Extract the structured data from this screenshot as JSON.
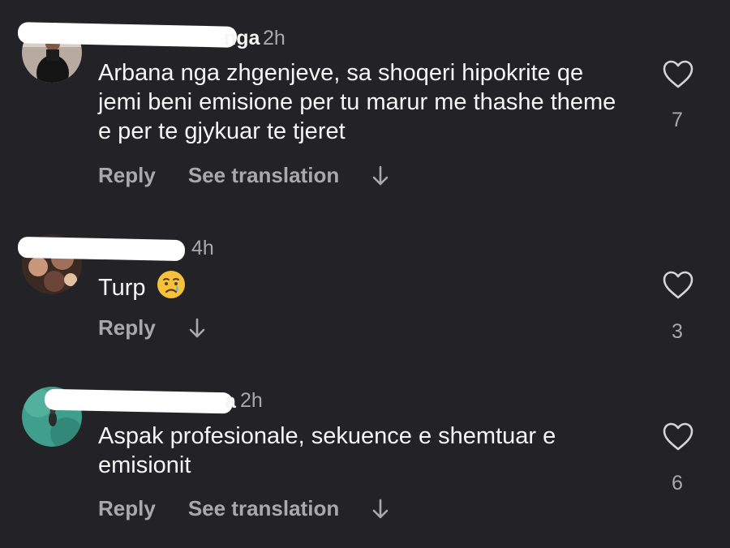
{
  "comments": [
    {
      "username_visible": "nga",
      "time": "2h",
      "text": "Arbana nga zhgenjeve, sa shoqeri hipokrite qe jemi beni emisione per tu marur me thashe theme e per te gjykuar te tjeret",
      "reply_label": "Reply",
      "translate_label": "See translation",
      "likes": "7"
    },
    {
      "time": "4h",
      "text": "Turp",
      "emoji": "crying-face",
      "reply_label": "Reply",
      "likes": "3"
    },
    {
      "username_visible": "a",
      "time": "2h",
      "text": "Aspak profesionale, sekuence e shemtuar e emisionit",
      "reply_label": "Reply",
      "translate_label": "See translation",
      "likes": "6"
    }
  ],
  "colors": {
    "background": "#222227",
    "primary_text": "#f5f5f5",
    "secondary_text": "#a8a8ad",
    "redaction": "#ffffff"
  }
}
